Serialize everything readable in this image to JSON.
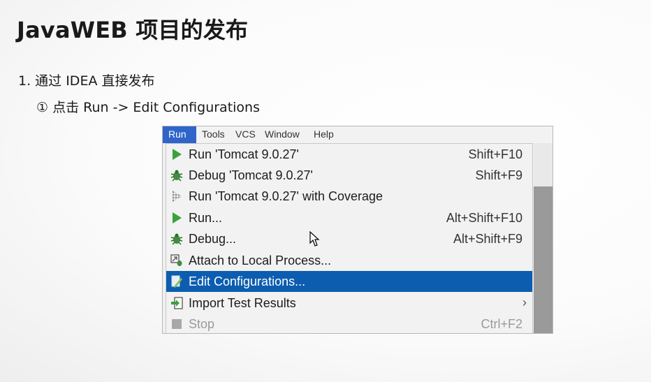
{
  "slide": {
    "title": "JavaWEB 项目的发布",
    "step1": "1. 通过 IDEA 直接发布",
    "step2": "① 点击 Run -> Edit Configurations"
  },
  "menubar": {
    "items": [
      "Run",
      "Tools",
      "VCS",
      "Window",
      "Help"
    ]
  },
  "run_menu": {
    "items": [
      {
        "label": "Run 'Tomcat 9.0.27'",
        "shortcut": "Shift+F10",
        "icon": "run-icon"
      },
      {
        "label": "Debug 'Tomcat 9.0.27'",
        "shortcut": "Shift+F9",
        "icon": "debug-icon"
      },
      {
        "label": "Run 'Tomcat 9.0.27' with Coverage",
        "shortcut": "",
        "icon": "coverage-icon"
      },
      {
        "label": "Run...",
        "shortcut": "Alt+Shift+F10",
        "icon": "run-icon"
      },
      {
        "label": "Debug...",
        "shortcut": "Alt+Shift+F9",
        "icon": "debug-icon"
      },
      {
        "label": "Attach to Local Process...",
        "shortcut": "",
        "icon": "attach-icon"
      },
      {
        "label": "Edit Configurations...",
        "shortcut": "",
        "icon": "edit-config-icon"
      },
      {
        "label": "Import Test Results",
        "shortcut": "",
        "icon": "import-icon",
        "submenu_arrow": "›"
      },
      {
        "label": "Stop",
        "shortcut": "Ctrl+F2",
        "icon": "stop-icon"
      }
    ]
  },
  "colors": {
    "selected": "#0c5db0",
    "run_green": "#3aa23a",
    "menubar_active": "#2f65ca"
  }
}
